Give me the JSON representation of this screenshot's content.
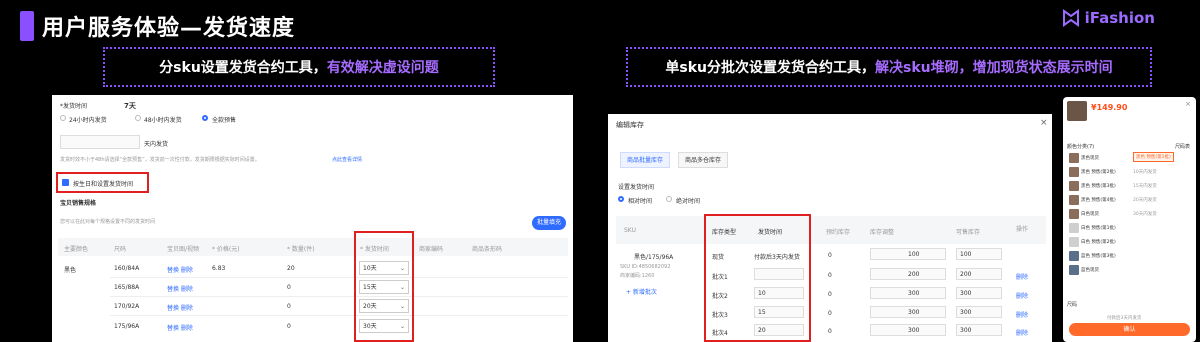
{
  "header": {
    "title": "用户服务体验—发货速度",
    "brand": "iFashion"
  },
  "banners": {
    "left_plain": "分sku设置发货合约工具，",
    "left_highlight": "有效解决虚设问题",
    "right_plain": "单sku分批次设置发货合约工具，",
    "right_highlight": "解决sku堆砌，增加现货状态展示时间"
  },
  "colors": {
    "accent": "#8a4fff",
    "highlight": "#e02020",
    "link": "#2f6bff",
    "orange": "#ff6a2a"
  },
  "left_panel": {
    "ship_time_label": "*发货时间",
    "days_value": "7天",
    "options": [
      "24小时内发货",
      "48小时内发货",
      "全款预售"
    ],
    "days_input_suffix": "天内发货",
    "tip": "发货时效不小于48h请选择“全款预售”，发货前一次性付款，发货期限根据实际时间设置。",
    "tip_link": "点此查看详情",
    "checkbox_label": "按生日和设置发货时间",
    "section_title": "宝贝销售规格",
    "section_desc": "您可以在此对每个规格设置不同的发货时间",
    "batch_button": "批量填充",
    "columns": [
      "主要颜色",
      "尺码",
      "宝贝图/视频",
      "* 价格(元)",
      "* 数量(件)",
      "* 发货时间",
      "商家编码",
      "商品条形码"
    ],
    "rows": [
      {
        "color": "黑色",
        "size": "160/84A",
        "media": "替换 删除",
        "price": "6.83",
        "qty": "20",
        "ship": "10天"
      },
      {
        "color": "",
        "size": "165/88A",
        "media": "替换 删除",
        "price": "",
        "qty": "0",
        "ship": "15天"
      },
      {
        "color": "",
        "size": "170/92A",
        "media": "替换 删除",
        "price": "",
        "qty": "0",
        "ship": "20天"
      },
      {
        "color": "",
        "size": "175/96A",
        "media": "替换 删除",
        "price": "",
        "qty": "0",
        "ship": "30天"
      }
    ]
  },
  "mid_panel": {
    "title": "编辑库存",
    "tabs": [
      "商品批量库存",
      "商品多仓库存"
    ],
    "ship_label": "设置发货时间",
    "radio_options": [
      "相对时间",
      "绝对时间"
    ],
    "columns": [
      "SKU",
      "库存类型",
      "发货时间",
      "预约库存",
      "库存调整",
      "可售库存",
      "操作"
    ],
    "sku_name": "黑色/175/96A",
    "sku_id": "SKU ID:4850682092",
    "sku_code": "商家编码:1260",
    "add_batch": "+ 新增批次",
    "rows": [
      {
        "type": "现货",
        "ship": "付款后3天内发货",
        "booked": "0",
        "adj": "100",
        "sellable": "100",
        "op": ""
      },
      {
        "type": "批次1",
        "ship": "",
        "booked": "0",
        "adj": "200",
        "sellable": "200",
        "op": "删除"
      },
      {
        "type": "批次2",
        "ship": "10",
        "booked": "0",
        "adj": "300",
        "sellable": "300",
        "op": "删除"
      },
      {
        "type": "批次3",
        "ship": "15",
        "booked": "0",
        "adj": "300",
        "sellable": "300",
        "op": "删除"
      },
      {
        "type": "批次4",
        "ship": "20",
        "booked": "0",
        "adj": "300",
        "sellable": "300",
        "op": "删除"
      }
    ]
  },
  "right_panel": {
    "price": "¥149.90",
    "section": "颜色分类(7)",
    "size_guide": "尺码表",
    "options": [
      "黑色现货",
      "黑色 预售(第1批)",
      "黑色 预售(第2批)",
      "黑色 预售(第3批)",
      "黑色 预售(第4批)",
      "白色现货",
      "白色 预售(第1批)",
      "白色 预售(第2批)",
      "蓝色 预售(第3批)",
      "蓝色现货"
    ],
    "ship_tags": [
      "10天内发货",
      "15天内发货",
      "20天内发货",
      "30天内发货"
    ],
    "size_label": "尺码",
    "notice": "付款后3天内发货",
    "confirm": "确认"
  }
}
